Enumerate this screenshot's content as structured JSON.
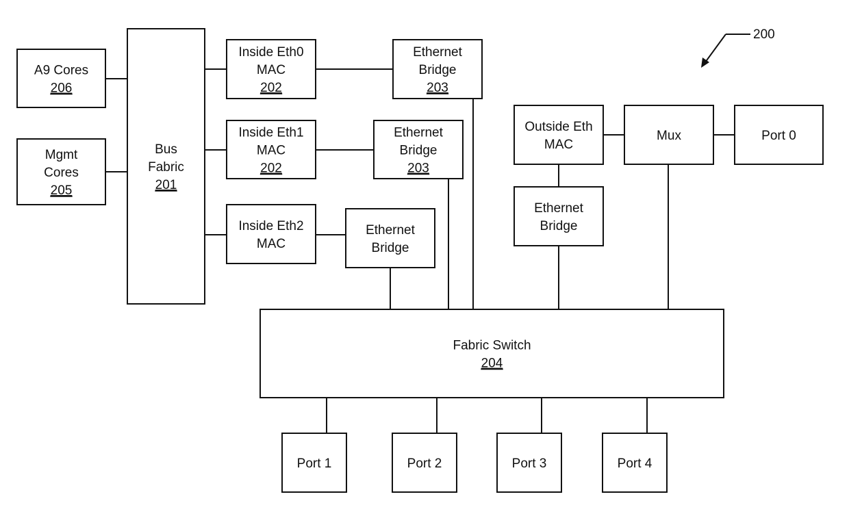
{
  "figure": {
    "reference": "200",
    "blocks": {
      "a9_cores": {
        "lines": [
          "A9 Cores"
        ],
        "ref": "206"
      },
      "mgmt_cores": {
        "lines": [
          "Mgmt",
          "Cores"
        ],
        "ref": "205"
      },
      "bus_fabric": {
        "lines": [
          "Bus",
          "Fabric"
        ],
        "ref": "201"
      },
      "inside_eth0_mac": {
        "lines": [
          "Inside Eth0",
          "MAC"
        ],
        "ref": "202"
      },
      "inside_eth1_mac": {
        "lines": [
          "Inside Eth1",
          "MAC"
        ],
        "ref": "202"
      },
      "inside_eth2_mac": {
        "lines": [
          "Inside Eth2",
          "MAC"
        ],
        "ref": ""
      },
      "ethernet_bridge_0": {
        "lines": [
          "Ethernet",
          "Bridge"
        ],
        "ref": "203"
      },
      "ethernet_bridge_1": {
        "lines": [
          "Ethernet",
          "Bridge"
        ],
        "ref": "203"
      },
      "ethernet_bridge_2": {
        "lines": [
          "Ethernet",
          "Bridge"
        ],
        "ref": ""
      },
      "outside_eth_mac": {
        "lines": [
          "Outside Eth",
          "MAC"
        ],
        "ref": ""
      },
      "outside_ethernet_bridge": {
        "lines": [
          "Ethernet",
          "Bridge"
        ],
        "ref": ""
      },
      "mux": {
        "lines": [
          "Mux"
        ],
        "ref": ""
      },
      "port_0": {
        "lines": [
          "Port 0"
        ],
        "ref": ""
      },
      "fabric_switch": {
        "lines": [
          "Fabric Switch"
        ],
        "ref": "204"
      },
      "port_1": {
        "lines": [
          "Port 1"
        ],
        "ref": ""
      },
      "port_2": {
        "lines": [
          "Port 2"
        ],
        "ref": ""
      },
      "port_3": {
        "lines": [
          "Port 3"
        ],
        "ref": ""
      },
      "port_4": {
        "lines": [
          "Port 4"
        ],
        "ref": ""
      }
    },
    "connections": [
      [
        "a9_cores",
        "bus_fabric"
      ],
      [
        "mgmt_cores",
        "bus_fabric"
      ],
      [
        "bus_fabric",
        "inside_eth0_mac"
      ],
      [
        "bus_fabric",
        "inside_eth1_mac"
      ],
      [
        "bus_fabric",
        "inside_eth2_mac"
      ],
      [
        "inside_eth0_mac",
        "ethernet_bridge_0"
      ],
      [
        "inside_eth1_mac",
        "ethernet_bridge_1"
      ],
      [
        "inside_eth2_mac",
        "ethernet_bridge_2"
      ],
      [
        "ethernet_bridge_0",
        "fabric_switch"
      ],
      [
        "ethernet_bridge_1",
        "fabric_switch"
      ],
      [
        "ethernet_bridge_2",
        "fabric_switch"
      ],
      [
        "outside_eth_mac",
        "mux"
      ],
      [
        "mux",
        "port_0"
      ],
      [
        "outside_eth_mac",
        "outside_ethernet_bridge"
      ],
      [
        "outside_ethernet_bridge",
        "fabric_switch"
      ],
      [
        "mux",
        "fabric_switch"
      ],
      [
        "fabric_switch",
        "port_1"
      ],
      [
        "fabric_switch",
        "port_2"
      ],
      [
        "fabric_switch",
        "port_3"
      ],
      [
        "fabric_switch",
        "port_4"
      ]
    ]
  }
}
